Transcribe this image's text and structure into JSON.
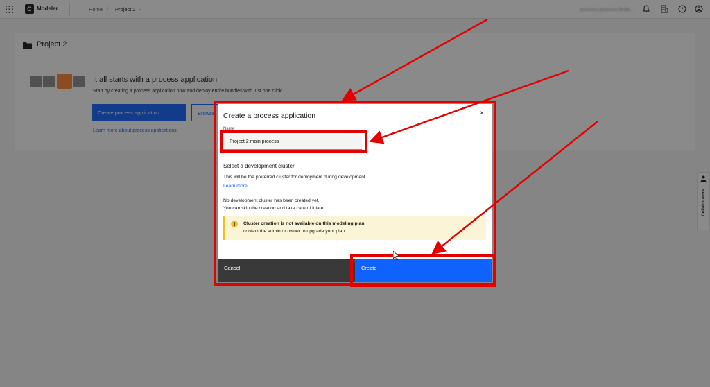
{
  "topbar": {
    "app_name": "Modeler",
    "breadcrumb_home": "Home",
    "breadcrumb_separator": "/",
    "breadcrumb_project": "Project 2",
    "user_name": "process process finds..."
  },
  "project": {
    "title": "Project 2",
    "hero_title": "It all starts with a process application",
    "hero_subtitle": "Start by creating a process application now and deploy entire bundles with just one click.",
    "create_button": "Create process application",
    "browse_button": "Browse",
    "learn_link": "Learn more about process applications"
  },
  "collaborators_label": "Collaborators",
  "modal": {
    "title": "Create a process application",
    "close_label": "×",
    "name_label": "Name",
    "name_value": "Project 2 main process",
    "cluster_title": "Select a development cluster",
    "cluster_description": "This will be the preferred cluster for deployment during development.",
    "learn_more": "Learn more",
    "no_cluster_line1": "No development cluster has been created yet.",
    "no_cluster_line2": "You can skip the creation and take care of it later.",
    "warning_title": "Cluster creation is not available on this modeling plan",
    "warning_subtitle": "contact the admin or owner to upgrade your plan.",
    "cancel_button": "Cancel",
    "create_button": "Create"
  },
  "colors": {
    "primary": "#0f62fe",
    "annotation_red": "#e30000",
    "warning_bg": "#fcf4d6",
    "warning_accent": "#f1c21b",
    "secondary_button": "#393939"
  },
  "icons": [
    "app-switcher-grid-icon",
    "logo-icon",
    "chevron-down-icon",
    "notification-icon",
    "organization-icon",
    "help-icon",
    "user-avatar-icon",
    "folder-icon",
    "close-icon",
    "warning-icon",
    "person-icon"
  ]
}
